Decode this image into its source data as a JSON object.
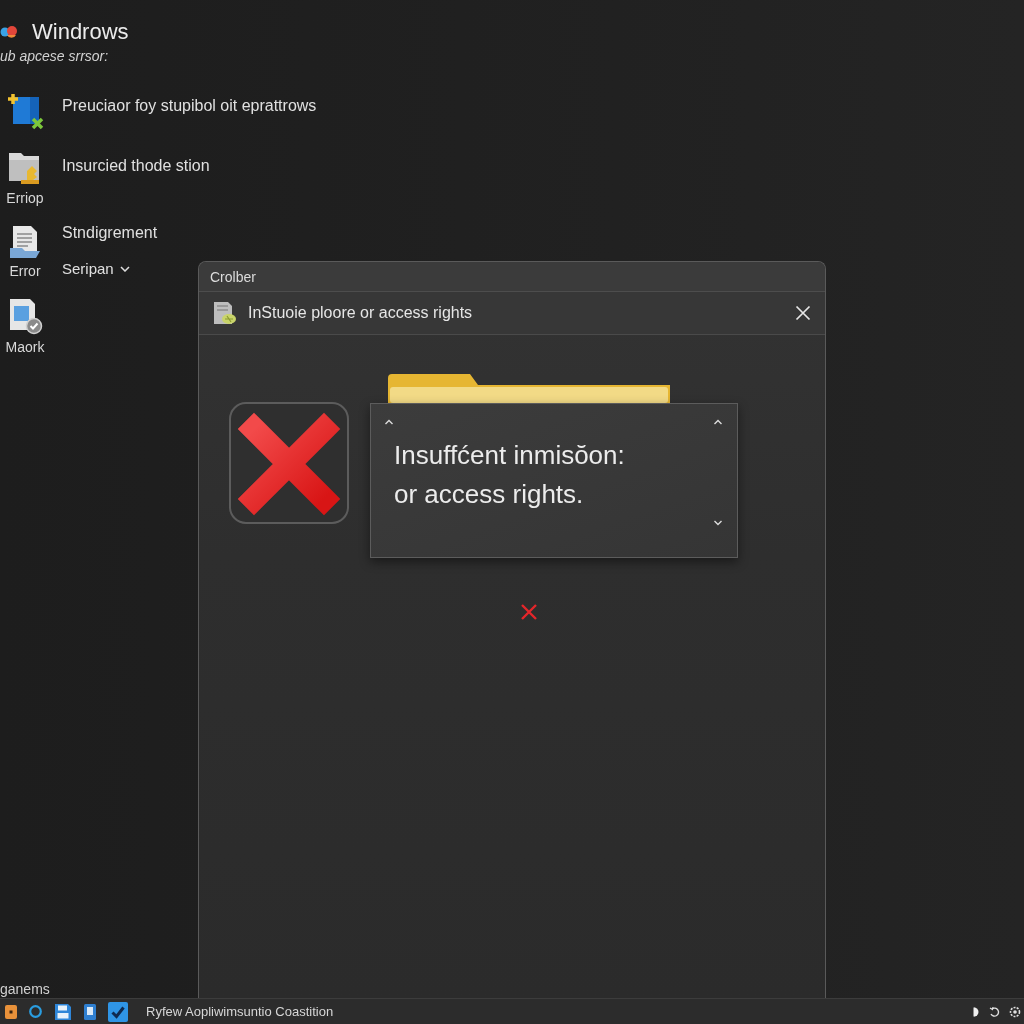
{
  "desktop": {
    "title": "Windrows",
    "subtitle": "ub apcese srrsor:",
    "items": [
      {
        "lines": [
          {
            "kind": "text",
            "text": "Preuciaor foy stupibol oit eprattrows"
          }
        ]
      },
      {
        "label": "Erriop",
        "lines": [
          {
            "kind": "text",
            "text": "Insurcied thode stion"
          }
        ]
      },
      {
        "label": "Error",
        "lines": [
          {
            "kind": "text",
            "text": "Stndigrement"
          },
          {
            "kind": "dropdown",
            "text": "Seripan"
          }
        ]
      },
      {
        "label": "Maork"
      }
    ],
    "footer": "ganems"
  },
  "dialog": {
    "title": "Crolber",
    "heading": "InStuoie ploore or access rights",
    "message": "Insuffćent inmisŏon:\nor access rights."
  },
  "taskbar": {
    "window_title": "Ryfew Aopliwimsuntio Coastition"
  }
}
